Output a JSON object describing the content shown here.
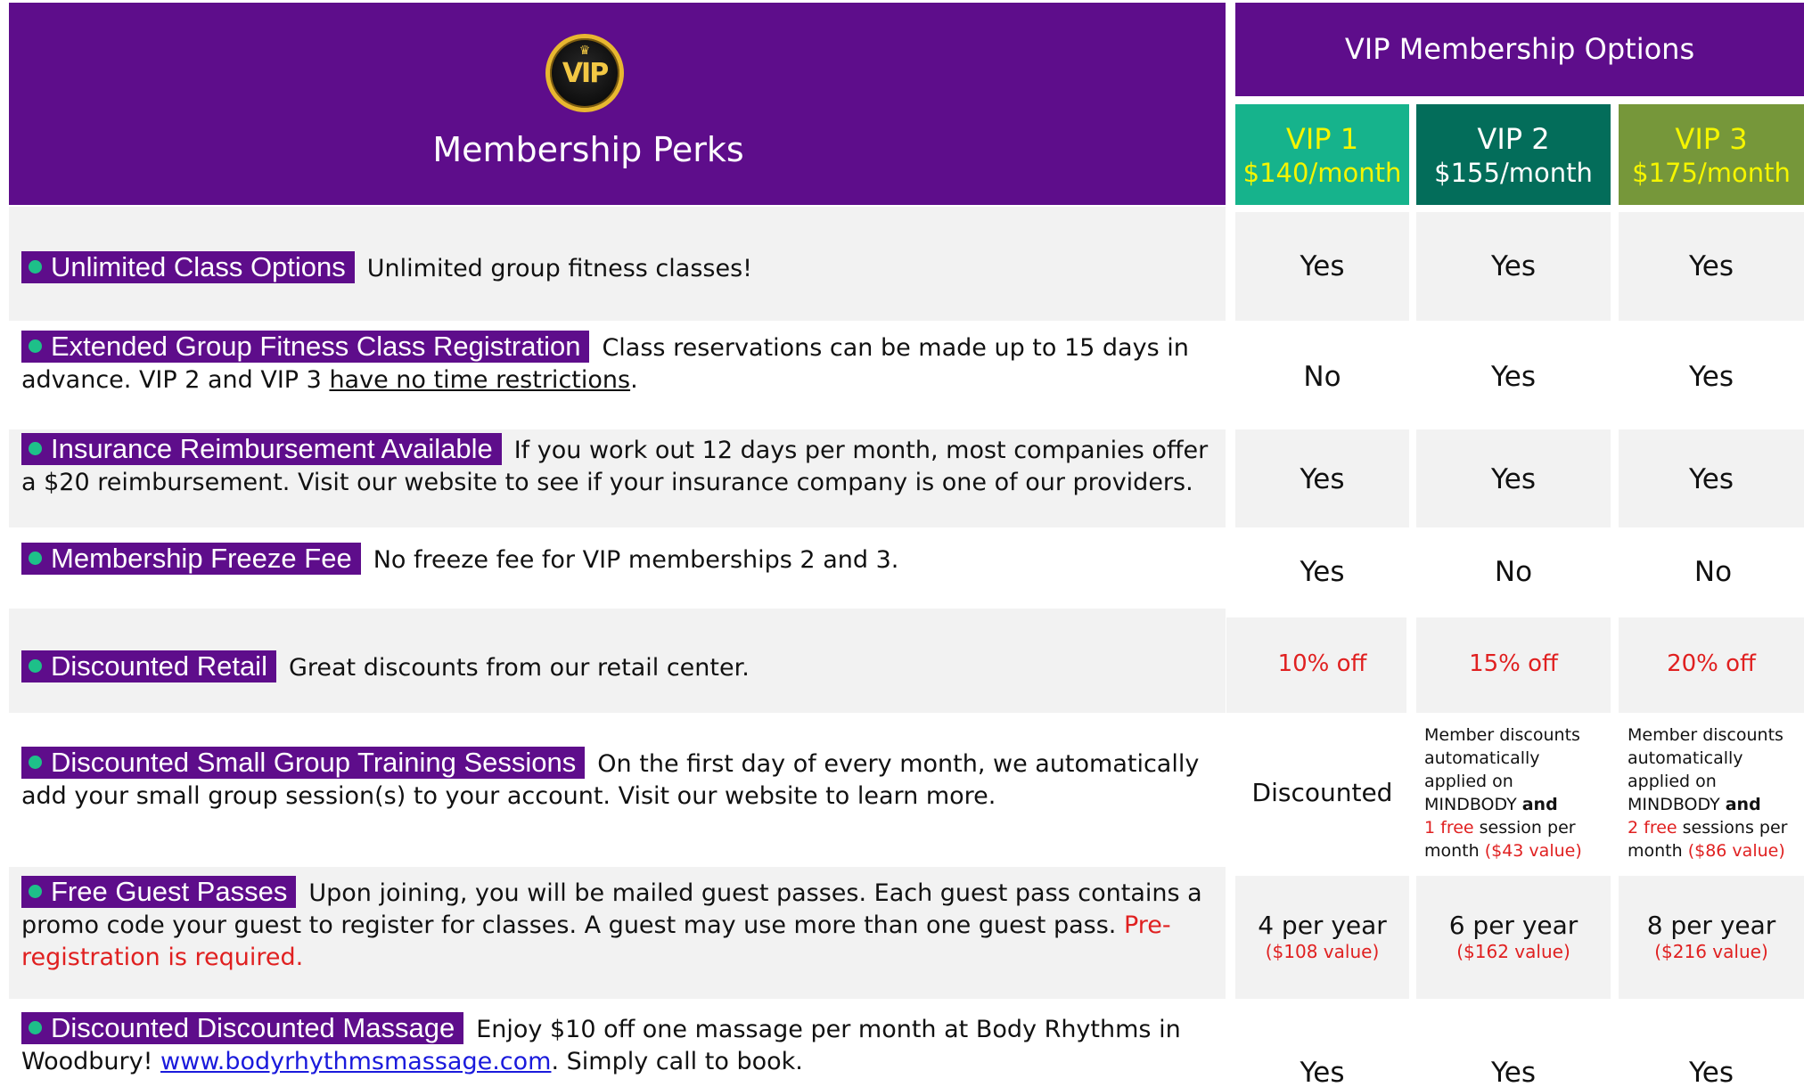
{
  "header": {
    "logo_text": "VIP",
    "perks_title": "Membership Perks",
    "options_title": "VIP Membership Options"
  },
  "tiers": [
    {
      "name": "VIP 1",
      "price": "$140/month"
    },
    {
      "name": "VIP 2",
      "price": "$155/month"
    },
    {
      "name": "VIP 3",
      "price": "$175/month"
    }
  ],
  "perks": [
    {
      "title": "Unlimited Class Options",
      "desc": "Unlimited group fitness classes!",
      "values": [
        "Yes",
        "Yes",
        "Yes"
      ]
    },
    {
      "title": "Extended Group Fitness Class Registration",
      "desc_a": "Class reservations can be made up to 15 days in advance. VIP 2 and VIP 3 ",
      "desc_underline": "have no time restrictions",
      "desc_b": ".",
      "values": [
        "No",
        "Yes",
        "Yes"
      ]
    },
    {
      "title": "Insurance Reimbursement Available",
      "desc": "If you work out 12 days per month, most companies offer a $20 reimbursement.  Visit our website to see if your insurance company is one of our providers.",
      "values": [
        "Yes",
        "Yes",
        "Yes"
      ]
    },
    {
      "title": "Membership Freeze Fee",
      "desc": "No freeze fee for VIP memberships 2 and 3.",
      "values": [
        "Yes",
        "No",
        "No"
      ]
    },
    {
      "title": "Discounted Retail",
      "desc": "Great discounts from our retail center.",
      "values": [
        "10% off",
        "15% off",
        "20% off"
      ]
    },
    {
      "title": "Discounted Small Group Training Sessions",
      "desc": "On the first day of every month, we automatically add your small group session(s) to your account.  Visit our website to learn more.",
      "value_1": "Discounted",
      "value_2": {
        "text_a": "Member discounts automatically applied on MINDBODY ",
        "bold": "and",
        "free": "1 free",
        "text_b": " session per month ",
        "worth": "($43 value)"
      },
      "value_3": {
        "text_a": "Member discounts automatically applied on MINDBODY ",
        "bold": "and",
        "free": "2 free",
        "text_b": " sessions per month ",
        "worth": "($86 value)"
      }
    },
    {
      "title": "Free Guest Passes",
      "desc": "Upon joining, you will be mailed guest passes. Each guest pass contains a promo code your guest to register for classes. A guest may use more than one guest pass. ",
      "desc_red": "Pre-registration is required.",
      "values": [
        {
          "main": "4 per year",
          "worth": "($108 value)"
        },
        {
          "main": "6 per year",
          "worth": "($162 value)"
        },
        {
          "main": "8 per year",
          "worth": "($216 value)"
        }
      ]
    },
    {
      "title": "Discounted Discounted Massage",
      "desc_a": "Enjoy $10 off one massage per month at Body Rhythms in Woodbury! ",
      "link": "www.bodyrhythmsmassage.com",
      "desc_b": ".  Simply call to book.",
      "values": [
        "Yes",
        "Yes",
        "Yes"
      ]
    }
  ],
  "colors": {
    "purple": "#5e0d8b",
    "tier1": "#16b38c",
    "tier2": "#036d5a",
    "tier3": "#76973a",
    "bullet": "#1ec089",
    "accent_red": "#e02020"
  }
}
